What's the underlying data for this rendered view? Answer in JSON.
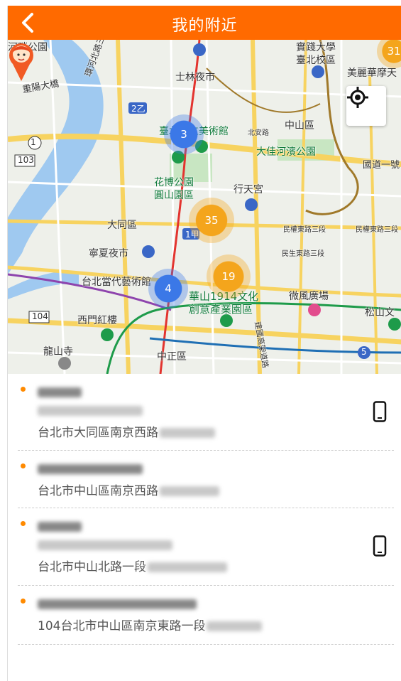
{
  "header": {
    "title": "我的附近",
    "back_icon": "chevron-left-icon"
  },
  "colors": {
    "brand": "#ff6a00",
    "dot": "#ff8a00",
    "cluster_blue": "#3b78e7",
    "cluster_orange": "#f4a51c"
  },
  "map": {
    "labels": {
      "top_left": "河畔公園",
      "shijian": "實踐大學",
      "taibei_campus": "臺北校區",
      "meili": "美麗華摩天",
      "shilin": "士林夜市",
      "huanhe": "環河北路三段",
      "chongyang": "重陽大橋",
      "art_museum": "臺北市立美術館",
      "zhongshan_district": "中山區",
      "dajia": "大佳河濱公園",
      "guodao": "國道一號",
      "flora1": "花博公園",
      "flora2": "圓山園區",
      "xingtian": "行天宮",
      "datong": "大同區",
      "ningxia": "寧夏夜市",
      "moca": "台北當代藝術館",
      "huashan1": "華山1914文化",
      "huashan2": "創意產業園區",
      "weifeng": "微風廣場",
      "songshan": "松山文",
      "ximen": "西門紅樓",
      "longshan": "龍山寺",
      "zhongzheng": "中正區",
      "minquan": "民權東路三段",
      "minsheng": "民生東路三段",
      "road_2z": "2乙",
      "road_1jia": "1甲",
      "road_103": "103",
      "road_104": "104",
      "road_1": "1",
      "road_5": "5",
      "beian": "北安路",
      "jianguo": "建國高架道路"
    },
    "clusters": [
      {
        "count": "3",
        "color": "blue"
      },
      {
        "count": "35",
        "color": "orange"
      },
      {
        "count": "19",
        "color": "orange"
      },
      {
        "count": "4",
        "color": "blue"
      },
      {
        "count": "31",
        "color": "orange"
      }
    ],
    "locate_icon": "crosshair-icon",
    "pin_icon": "avatar-pin-icon"
  },
  "list": [
    {
      "address": "台北市大同區南京西路",
      "has_phone": true
    },
    {
      "address": "台北市中山區南京西路",
      "has_phone": false
    },
    {
      "address": "台北市中山北路一段",
      "has_phone": true
    },
    {
      "address": "104台北市中山區南京東路一段",
      "has_phone": false
    }
  ],
  "phone_icon": "mobile-phone-icon"
}
